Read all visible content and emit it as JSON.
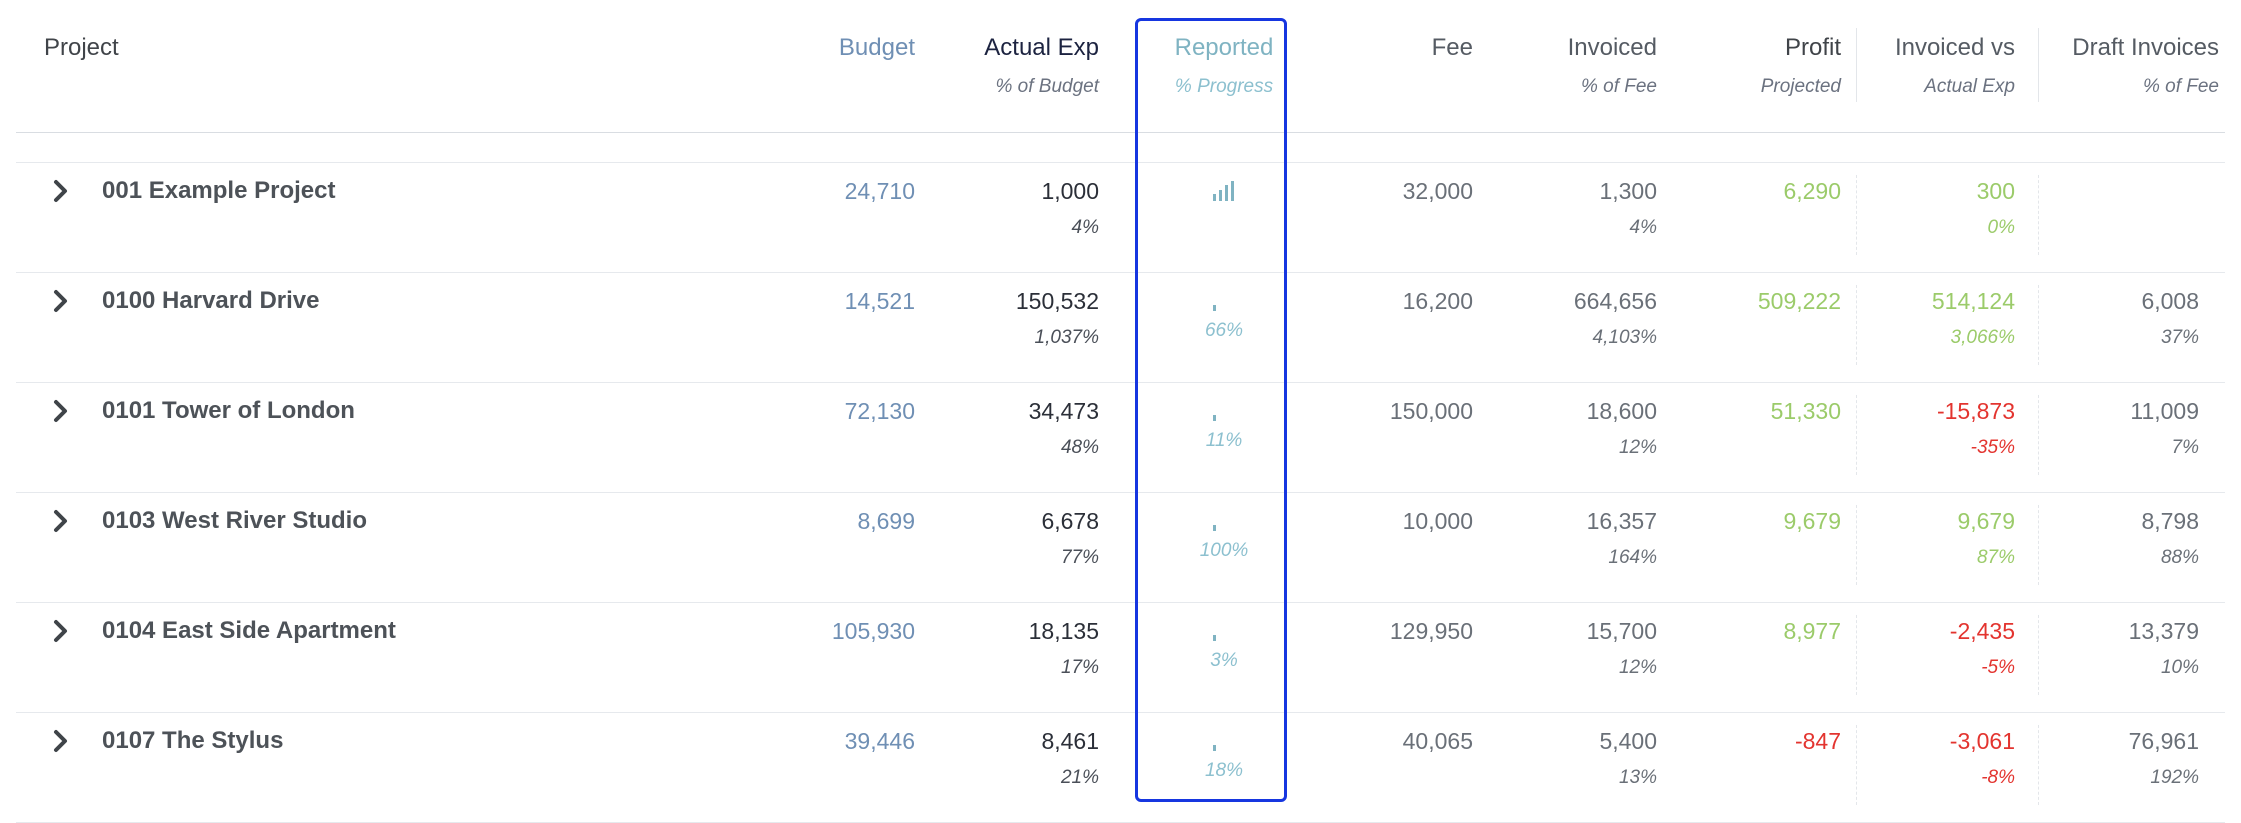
{
  "columns": {
    "project": {
      "title": "Project"
    },
    "budget": {
      "title": "Budget"
    },
    "actual_exp": {
      "title": "Actual Exp",
      "sub": "% of Budget"
    },
    "reported": {
      "title": "Reported",
      "sub": "% Progress"
    },
    "fee": {
      "title": "Fee"
    },
    "invoiced": {
      "title": "Invoiced",
      "sub": "% of Fee"
    },
    "profit": {
      "title": "Profit",
      "sub": "Projected"
    },
    "inv_vs_actual": {
      "title": "Invoiced vs",
      "sub": "Actual Exp"
    },
    "draft_invoices": {
      "title": "Draft Invoices",
      "sub": "% of Fee"
    }
  },
  "rows": [
    {
      "name": "001 Example Project",
      "budget": "24,710",
      "actual": "1,000",
      "actual_pct": "4%",
      "reported_pct": "",
      "reported_progress": 0,
      "fee": "32,000",
      "invoiced": "1,300",
      "invoiced_pct": "4%",
      "profit": "6,290",
      "profit_status": "positive",
      "inv_vs": "300",
      "inv_vs_pct": "0%",
      "inv_vs_status": "positive",
      "draft": "",
      "draft_pct": ""
    },
    {
      "name": "0100 Harvard Drive",
      "budget": "14,521",
      "actual": "150,532",
      "actual_pct": "1,037%",
      "reported_pct": "66%",
      "reported_progress": 66,
      "fee": "16,200",
      "invoiced": "664,656",
      "invoiced_pct": "4,103%",
      "profit": "509,222",
      "profit_status": "positive",
      "inv_vs": "514,124",
      "inv_vs_pct": "3,066%",
      "inv_vs_status": "positive",
      "draft": "6,008",
      "draft_pct": "37%"
    },
    {
      "name": "0101 Tower of London",
      "budget": "72,130",
      "actual": "34,473",
      "actual_pct": "48%",
      "reported_pct": "11%",
      "reported_progress": 11,
      "fee": "150,000",
      "invoiced": "18,600",
      "invoiced_pct": "12%",
      "profit": "51,330",
      "profit_status": "positive",
      "inv_vs": "-15,873",
      "inv_vs_pct": "-35%",
      "inv_vs_status": "negative",
      "draft": "11,009",
      "draft_pct": "7%"
    },
    {
      "name": "0103 West River Studio",
      "budget": "8,699",
      "actual": "6,678",
      "actual_pct": "77%",
      "reported_pct": "100%",
      "reported_progress": 100,
      "fee": "10,000",
      "invoiced": "16,357",
      "invoiced_pct": "164%",
      "profit": "9,679",
      "profit_status": "positive",
      "inv_vs": "9,679",
      "inv_vs_pct": "87%",
      "inv_vs_status": "positive",
      "draft": "8,798",
      "draft_pct": "88%"
    },
    {
      "name": "0104 East Side Apartment",
      "budget": "105,930",
      "actual": "18,135",
      "actual_pct": "17%",
      "reported_pct": "3%",
      "reported_progress": 3,
      "fee": "129,950",
      "invoiced": "15,700",
      "invoiced_pct": "12%",
      "profit": "8,977",
      "profit_status": "positive",
      "inv_vs": "-2,435",
      "inv_vs_pct": "-5%",
      "inv_vs_status": "negative",
      "draft": "13,379",
      "draft_pct": "10%"
    },
    {
      "name": "0107 The Stylus",
      "budget": "39,446",
      "actual": "8,461",
      "actual_pct": "21%",
      "reported_pct": "18%",
      "reported_progress": 18,
      "fee": "40,065",
      "invoiced": "5,400",
      "invoiced_pct": "13%",
      "profit": "-847",
      "profit_status": "negative",
      "inv_vs": "-3,061",
      "inv_vs_pct": "-8%",
      "inv_vs_status": "negative",
      "draft": "76,961",
      "draft_pct": "192%"
    }
  ],
  "colors": {
    "budget": "#6f8fb4",
    "actual_title": "#1c2340",
    "reported": "#7fb3c2",
    "positive": "#9bcb6a",
    "negative": "#e3342f",
    "highlight": "#1636e0",
    "text": "#50555c"
  },
  "icons": {
    "expand": "chevron-right-icon",
    "progress": "bar-chart-icon"
  }
}
